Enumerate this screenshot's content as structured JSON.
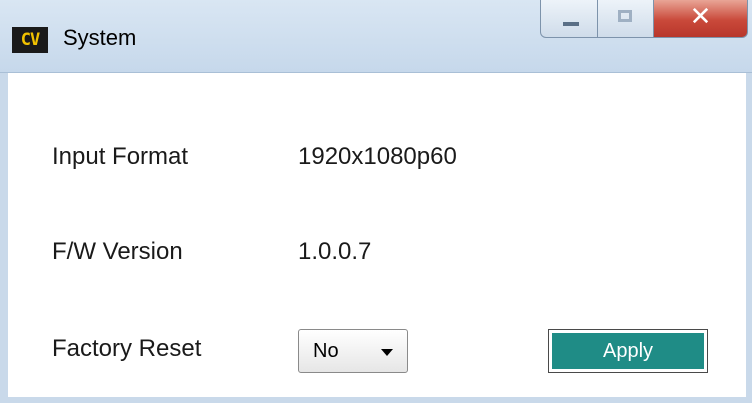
{
  "window": {
    "app_icon_text": "CV",
    "title": "System",
    "caption_buttons": [
      "minimize",
      "maximize",
      "close"
    ]
  },
  "fields": {
    "input_format": {
      "label": "Input Format",
      "value": "1920x1080p60"
    },
    "fw_version": {
      "label": "F/W Version",
      "value": "1.0.0.7"
    },
    "factory_reset": {
      "label": "Factory Reset",
      "selected": "No"
    }
  },
  "apply_label": "Apply",
  "colors": {
    "apply_bg": "#1f8c86",
    "close_button": "#c9493a",
    "titlebar": "#c6d8eb"
  }
}
